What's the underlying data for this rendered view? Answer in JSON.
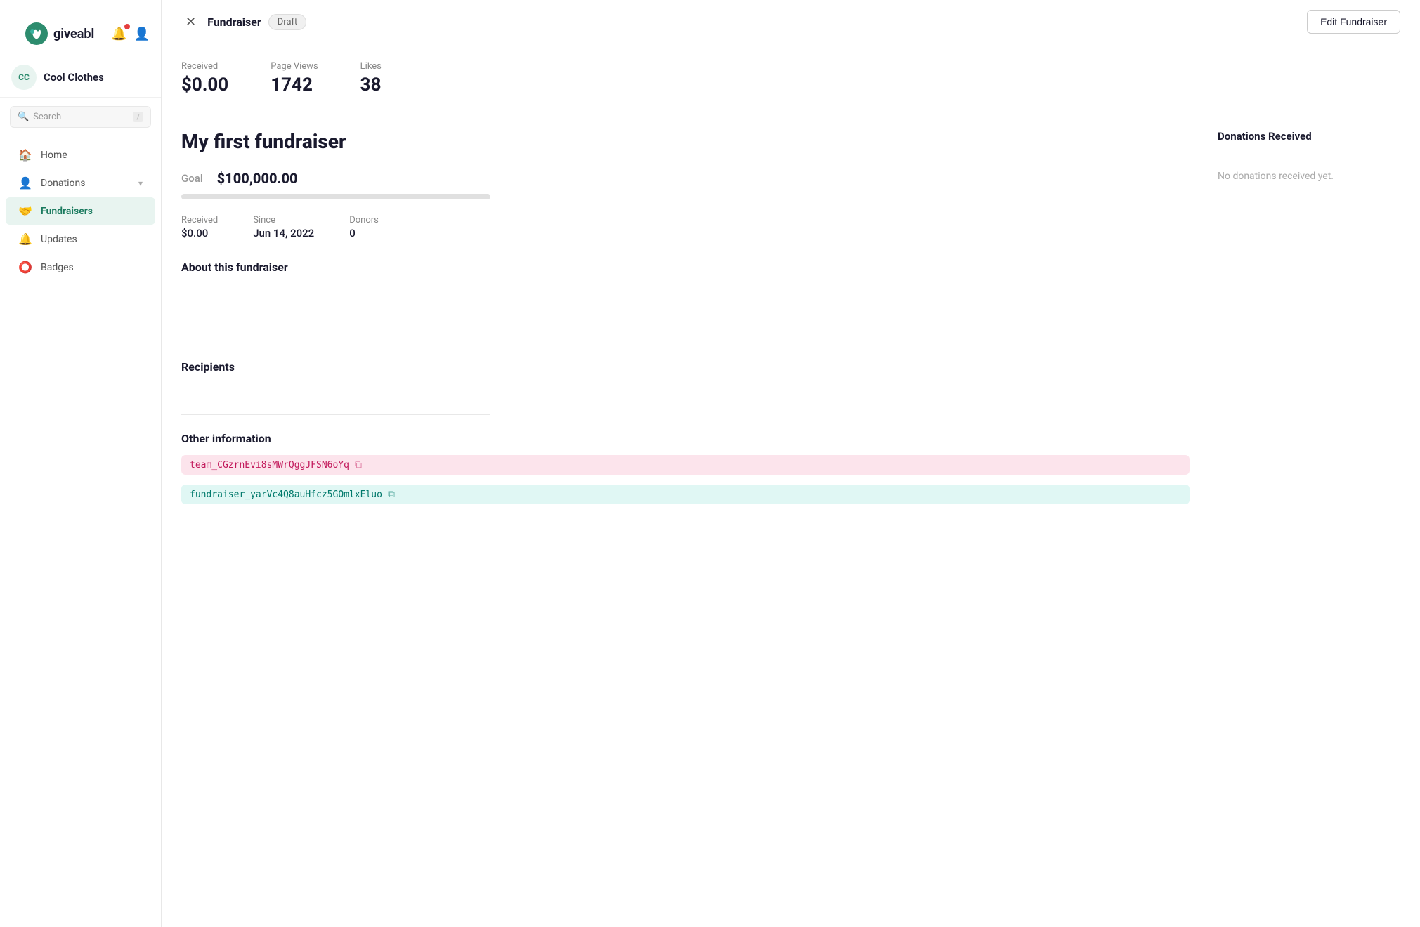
{
  "app": {
    "logo_text": "giveabl"
  },
  "org": {
    "initials": "CC",
    "name": "Cool Clothes"
  },
  "search": {
    "placeholder": "Search",
    "shortcut": "/"
  },
  "nav": {
    "items": [
      {
        "id": "home",
        "label": "Home",
        "icon": "🏠",
        "active": false
      },
      {
        "id": "donations",
        "label": "Donations",
        "icon": "👤",
        "active": false,
        "has_chevron": true
      },
      {
        "id": "fundraisers",
        "label": "Fundraisers",
        "icon": "🤝",
        "active": true
      },
      {
        "id": "updates",
        "label": "Updates",
        "icon": "🔔",
        "active": false
      },
      {
        "id": "badges",
        "label": "Badges",
        "icon": "⭕",
        "active": false
      }
    ]
  },
  "topbar": {
    "title": "Fundraiser",
    "status": "Draft",
    "edit_label": "Edit Fundraiser"
  },
  "stats": [
    {
      "label": "Received",
      "value": "$0.00"
    },
    {
      "label": "Page Views",
      "value": "1742"
    },
    {
      "label": "Likes",
      "value": "38"
    }
  ],
  "fundraiser": {
    "title": "My first fundraiser",
    "goal_label": "Goal",
    "goal_amount": "$100,000.00",
    "progress_percent": 0,
    "received_label": "Received",
    "received_value": "$0.00",
    "since_label": "Since",
    "since_value": "Jun 14, 2022",
    "donors_label": "Donors",
    "donors_value": "0",
    "about_title": "About this fundraiser",
    "about_text": "",
    "recipients_title": "Recipients",
    "other_info_title": "Other information",
    "tags": [
      {
        "id": "team-tag",
        "value": "team_CGzrnEvi8sMWrQggJFSN6oYq",
        "color": "pink"
      },
      {
        "id": "fundraiser-tag",
        "value": "fundraiser_yarVc4Q8auHfcz5GOmlxEluo",
        "color": "teal"
      }
    ]
  },
  "donations_panel": {
    "title": "Donations Received",
    "empty_text": "No donations received yet."
  }
}
